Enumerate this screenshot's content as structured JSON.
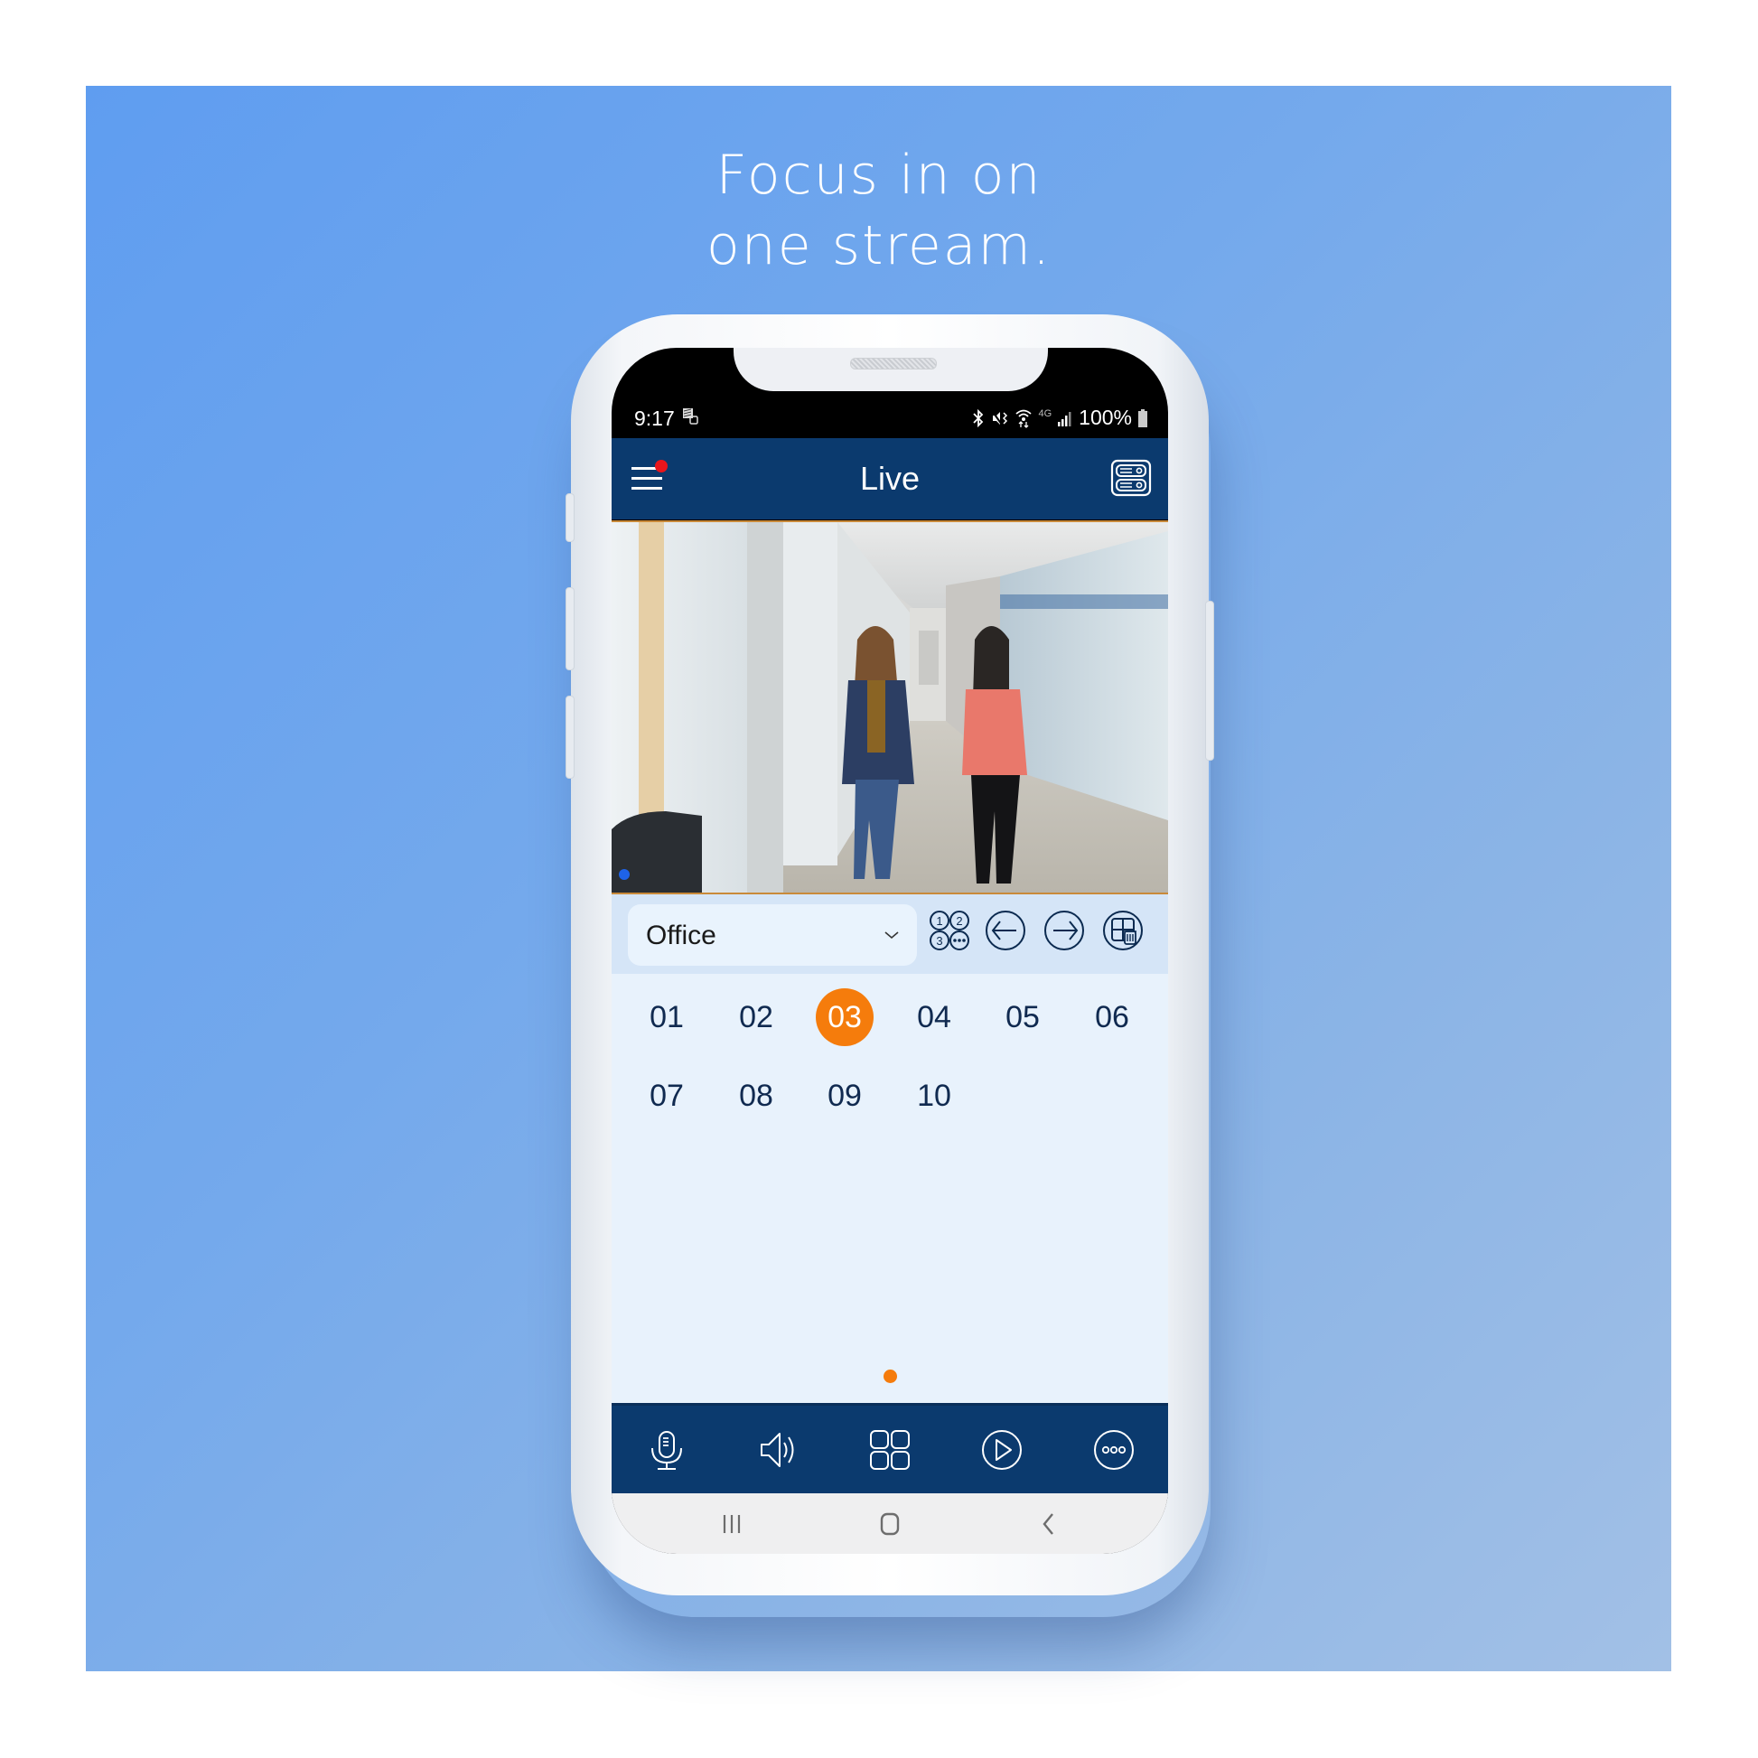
{
  "marketing": {
    "headline_line1": "Focus in on",
    "headline_line2": "one stream.",
    "background_color_start": "#5f9df0",
    "background_color_end": "#a2c0e6"
  },
  "status_bar": {
    "time": "9:17",
    "left_icons": [
      "screenshot-notification-icon"
    ],
    "right_icons": [
      "bluetooth-icon",
      "vibrate-mute-icon",
      "wifi-icon",
      "4g-icon",
      "signal-icon"
    ],
    "network_label": "4G",
    "battery": "100%"
  },
  "app_bar": {
    "title": "Live",
    "menu_icon": "hamburger-menu-icon",
    "menu_has_notification": true,
    "right_icon": "device-list-icon",
    "color": "#0b3a6e"
  },
  "video": {
    "description": "Live camera feed: two women walking down an office hallway",
    "border_color": "#c98a3a"
  },
  "controls": {
    "group_select": {
      "value": "Office"
    },
    "buttons": [
      {
        "name": "channel-number-icon",
        "label": "Channel numbers"
      },
      {
        "name": "previous-arrow-icon",
        "label": "Previous"
      },
      {
        "name": "next-arrow-icon",
        "label": "Next"
      },
      {
        "name": "delete-layout-icon",
        "label": "Delete layout"
      }
    ]
  },
  "channels": {
    "items": [
      "01",
      "02",
      "03",
      "04",
      "05",
      "06",
      "07",
      "08",
      "09",
      "10"
    ],
    "selected": "03",
    "accent_color": "#f57c0c"
  },
  "pager": {
    "pages": 1,
    "current": 1
  },
  "toolbar": {
    "items": [
      {
        "name": "microphone-icon",
        "label": "Talk"
      },
      {
        "name": "speaker-icon",
        "label": "Audio"
      },
      {
        "name": "grid-layout-icon",
        "label": "Layout"
      },
      {
        "name": "playback-icon",
        "label": "Playback"
      },
      {
        "name": "more-icon",
        "label": "More"
      }
    ]
  },
  "system_nav": {
    "items": [
      "recent-apps-icon",
      "home-icon",
      "back-icon"
    ]
  }
}
